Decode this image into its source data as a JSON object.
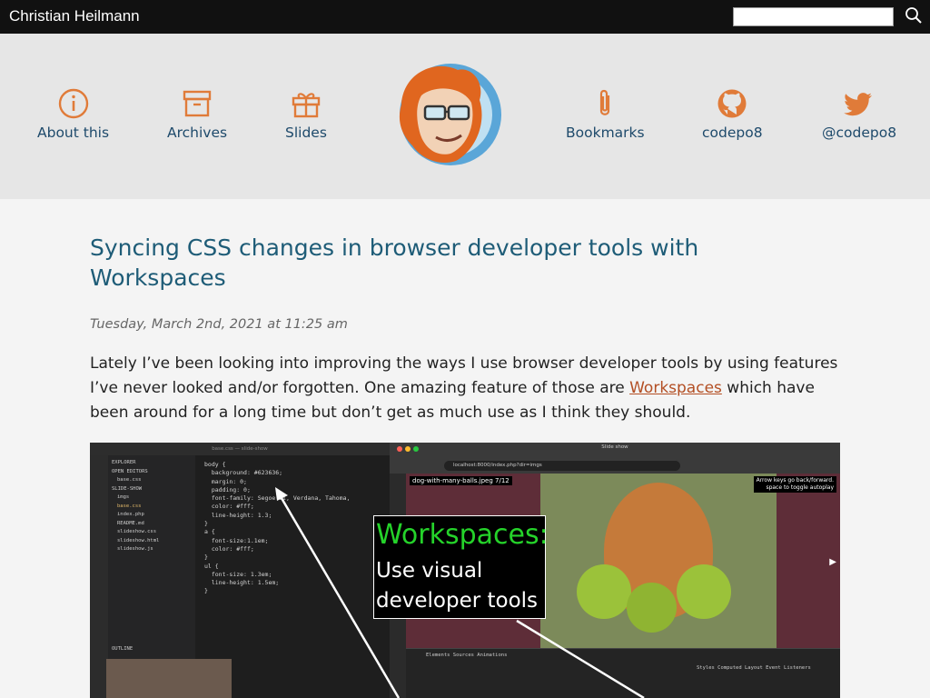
{
  "topbar": {
    "site_title": "Christian Heilmann",
    "search": {
      "value": "",
      "placeholder": ""
    }
  },
  "nav": {
    "left": [
      {
        "label": "About this",
        "icon": "info-icon"
      },
      {
        "label": "Archives",
        "icon": "archive-box-icon"
      },
      {
        "label": "Slides",
        "icon": "gift-icon"
      }
    ],
    "right": [
      {
        "label": "Bookmarks",
        "icon": "paperclip-icon"
      },
      {
        "label": "codepo8",
        "icon": "github-icon"
      },
      {
        "label": "@codepo8",
        "icon": "twitter-icon"
      }
    ]
  },
  "colors": {
    "topbar_bg": "#111111",
    "header_bg": "#e6e6e6",
    "icon_orange": "#e07b39",
    "nav_text": "#1e4a6b",
    "title_blue": "#1e5c77",
    "link_rust": "#b34f24"
  },
  "post": {
    "title": "Syncing CSS changes in browser developer tools with Workspaces",
    "date": "Tuesday, March 2nd, 2021 at 11:25 am",
    "intro_before": "Lately I’ve been looking into improving the ways I use browser developer tools by using features I’ve never looked and/or forgotten. One amazing feature of those are ",
    "intro_link": "Workspaces",
    "intro_after": " which have been around for a long time but don’t get as much use as I think they should."
  },
  "figure": {
    "editor_title": "base.css — slide-show",
    "editor_tab": "base.css",
    "explorer": [
      "EXPLORER",
      "OPEN EDITORS",
      "base.css",
      "SLIDE-SHOW",
      "imgs",
      "base.css",
      "index.php",
      "README.md",
      "slideshow.css",
      "slideshow.html",
      "slideshow.js",
      "OUTLINE"
    ],
    "code": "body {\n  background: #623636;\n  margin: 0;\n  padding: 0;\n  font-family: Segoe UI, Verdana, Tahoma,\n  color: #fff;\n  line-height: 1.3;\n}\na {\n  font-size:1.1em;\n  color: #fff;\n}\nul {\n  font-size: 1.3em;\n  line-height: 1.5em;\n}",
    "browser_title": "Slide show",
    "url": "localhost:8000/index.php?dir=imgs",
    "slide_caption": "dog-with-many-balls.jpeg 7/12",
    "slide_hint_1": "Arrow keys go back/forward.",
    "slide_hint_2": "space to toggle autoplay",
    "overlay_title": "Workspaces:",
    "overlay_line1": "Use visual",
    "overlay_line2": "developer tools",
    "devtools_tabs": "Elements   Sources   Animations",
    "devtools_styles": "Styles   Computed   Layout   Event Listeners"
  }
}
